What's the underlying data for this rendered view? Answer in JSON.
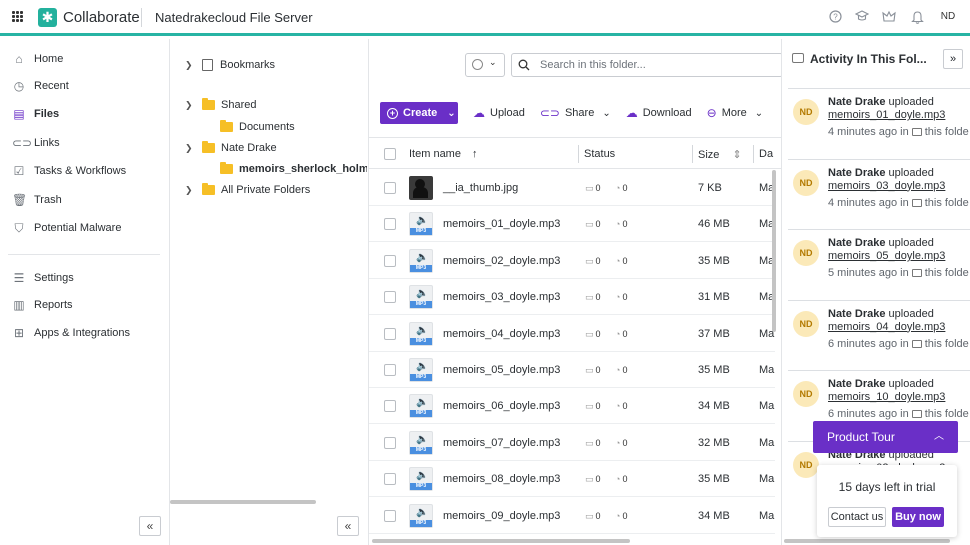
{
  "header": {
    "brand": "Collaborate",
    "server_name": "Natedrakecloud File Server",
    "user_initials": "ND"
  },
  "sidebar": {
    "items": [
      {
        "label": "Home",
        "icon": "home-icon"
      },
      {
        "label": "Recent",
        "icon": "clock-icon"
      },
      {
        "label": "Files",
        "icon": "files-icon"
      },
      {
        "label": "Links",
        "icon": "link-icon"
      },
      {
        "label": "Tasks & Workflows",
        "icon": "tasks-icon"
      },
      {
        "label": "Trash",
        "icon": "trash-icon"
      },
      {
        "label": "Potential Malware",
        "icon": "shield-icon"
      },
      {
        "label": "Settings",
        "icon": "settings-icon"
      },
      {
        "label": "Reports",
        "icon": "reports-icon"
      },
      {
        "label": "Apps & Integrations",
        "icon": "apps-icon"
      }
    ]
  },
  "tree": {
    "bookmarks": "Bookmarks",
    "shared": "Shared",
    "documents": "Documents",
    "nate": "Nate Drake",
    "selected_folder": "memoirs_sherlock_holmes_",
    "private": "All Private Folders"
  },
  "search": {
    "placeholder": "Search in this folder..."
  },
  "toolbar": {
    "create": "Create",
    "upload": "Upload",
    "share": "Share",
    "download": "Download",
    "more": "More"
  },
  "table": {
    "headers": {
      "name": "Item name",
      "status": "Status",
      "size": "Size",
      "date": "Da"
    },
    "rows": [
      {
        "name": "__ia_thumb.jpg",
        "type": "image",
        "comments": "0",
        "versions": "0",
        "size": "7 KB",
        "date": "Ma"
      },
      {
        "name": "memoirs_01_doyle.mp3",
        "type": "mp3",
        "comments": "0",
        "versions": "0",
        "size": "46 MB",
        "date": "Ma"
      },
      {
        "name": "memoirs_02_doyle.mp3",
        "type": "mp3",
        "comments": "0",
        "versions": "0",
        "size": "35 MB",
        "date": "Ma"
      },
      {
        "name": "memoirs_03_doyle.mp3",
        "type": "mp3",
        "comments": "0",
        "versions": "0",
        "size": "31 MB",
        "date": "Ma"
      },
      {
        "name": "memoirs_04_doyle.mp3",
        "type": "mp3",
        "comments": "0",
        "versions": "0",
        "size": "37 MB",
        "date": "Ma"
      },
      {
        "name": "memoirs_05_doyle.mp3",
        "type": "mp3",
        "comments": "0",
        "versions": "0",
        "size": "35 MB",
        "date": "Ma"
      },
      {
        "name": "memoirs_06_doyle.mp3",
        "type": "mp3",
        "comments": "0",
        "versions": "0",
        "size": "34 MB",
        "date": "Ma"
      },
      {
        "name": "memoirs_07_doyle.mp3",
        "type": "mp3",
        "comments": "0",
        "versions": "0",
        "size": "32 MB",
        "date": "Ma"
      },
      {
        "name": "memoirs_08_doyle.mp3",
        "type": "mp3",
        "comments": "0",
        "versions": "0",
        "size": "35 MB",
        "date": "Ma"
      },
      {
        "name": "memoirs_09_doyle.mp3",
        "type": "mp3",
        "comments": "0",
        "versions": "0",
        "size": "34 MB",
        "date": "Ma"
      }
    ]
  },
  "activity": {
    "title": "Activity In This Fol...",
    "items": [
      {
        "initials": "ND",
        "user": "Nate Drake",
        "action": "uploaded",
        "file": "memoirs_01_doyle.mp3",
        "time": "4 minutes ago in",
        "place": "this folde"
      },
      {
        "initials": "ND",
        "user": "Nate Drake",
        "action": "uploaded",
        "file": "memoirs_03_doyle.mp3",
        "time": "4 minutes ago in",
        "place": "this folde"
      },
      {
        "initials": "ND",
        "user": "Nate Drake",
        "action": "uploaded",
        "file": "memoirs_05_doyle.mp3",
        "time": "5 minutes ago in",
        "place": "this folde"
      },
      {
        "initials": "ND",
        "user": "Nate Drake",
        "action": "uploaded",
        "file": "memoirs_04_doyle.mp3",
        "time": "6 minutes ago in",
        "place": "this folde"
      },
      {
        "initials": "ND",
        "user": "Nate Drake",
        "action": "uploaded",
        "file": "memoirs_10_doyle.mp3",
        "time": "6 minutes ago in",
        "place": "this folde"
      },
      {
        "initials": "ND",
        "user": "Nate Drake",
        "action": "uploaded",
        "file": "memoirs_02_doyle.mp3",
        "time": "",
        "place": ""
      }
    ]
  },
  "tour": {
    "label": "Product Tour"
  },
  "trial": {
    "text": "15 days left in trial",
    "contact": "Contact us",
    "buy": "Buy now"
  },
  "colors": {
    "accent": "#6a2fc7",
    "brand": "#23b19d",
    "folder": "#f6bf26"
  }
}
